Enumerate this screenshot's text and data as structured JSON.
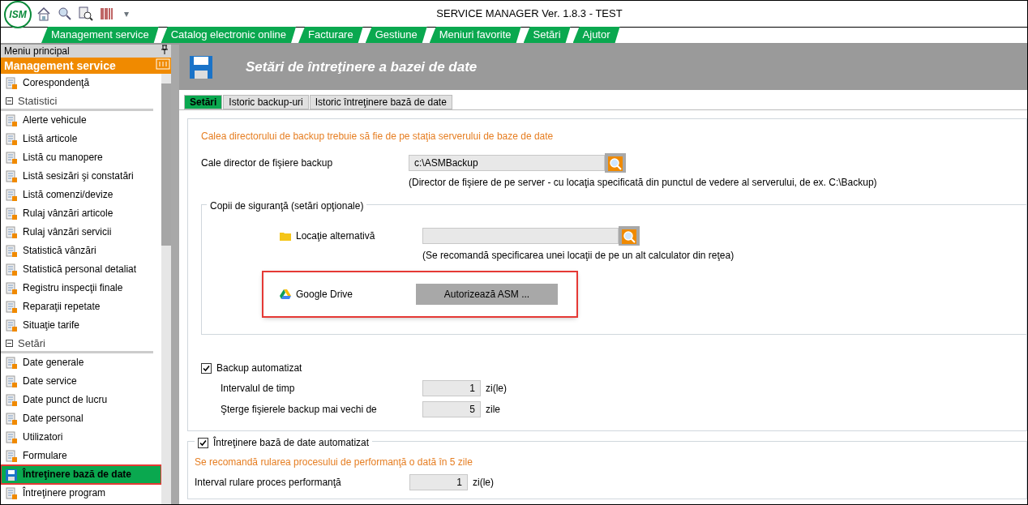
{
  "window": {
    "title": "SERVICE MANAGER Ver. 1.8.3 - TEST",
    "logo": "ISM",
    "overflow": "▾"
  },
  "menu": [
    {
      "label": "Management service"
    },
    {
      "label": "Catalog electronic online"
    },
    {
      "label": "Facturare"
    },
    {
      "label": "Gestiune"
    },
    {
      "label": "Meniuri favorite"
    },
    {
      "label": "Setări"
    },
    {
      "label": "Ajutor"
    }
  ],
  "sidebar": {
    "title": "Meniu principal",
    "header": "Management service",
    "items": [
      {
        "kind": "item",
        "label": "Corespondenţă",
        "selected": false
      },
      {
        "kind": "section",
        "label": "Statistici"
      },
      {
        "kind": "item",
        "label": "Alerte vehicule",
        "selected": false
      },
      {
        "kind": "item",
        "label": "Listă articole",
        "selected": false
      },
      {
        "kind": "item",
        "label": "Listă cu manopere",
        "selected": false
      },
      {
        "kind": "item",
        "label": "Listă sesizări şi constatări",
        "selected": false
      },
      {
        "kind": "item",
        "label": "Listă comenzi/devize",
        "selected": false
      },
      {
        "kind": "item",
        "label": "Rulaj vânzări articole",
        "selected": false
      },
      {
        "kind": "item",
        "label": "Rulaj vânzări servicii",
        "selected": false
      },
      {
        "kind": "item",
        "label": "Statistică vânzări",
        "selected": false
      },
      {
        "kind": "item",
        "label": "Statistică personal detaliat",
        "selected": false
      },
      {
        "kind": "item",
        "label": "Registru inspecţii finale",
        "selected": false
      },
      {
        "kind": "item",
        "label": "Reparaţii repetate",
        "selected": false
      },
      {
        "kind": "item",
        "label": "Situaţie tarife",
        "selected": false
      },
      {
        "kind": "section",
        "label": "Setări"
      },
      {
        "kind": "item",
        "label": "Date generale",
        "selected": false
      },
      {
        "kind": "item",
        "label": "Date service",
        "selected": false
      },
      {
        "kind": "item",
        "label": "Date punct de lucru",
        "selected": false
      },
      {
        "kind": "item",
        "label": "Date personal",
        "selected": false
      },
      {
        "kind": "item",
        "label": "Utilizatori",
        "selected": false
      },
      {
        "kind": "item",
        "label": "Formulare",
        "selected": false
      },
      {
        "kind": "item",
        "label": "Întreţinere bază de date",
        "selected": true
      },
      {
        "kind": "item",
        "label": "Întreţinere program",
        "selected": false
      }
    ]
  },
  "page": {
    "title": "Setări de întreţinere a bazei de date",
    "tabs": [
      {
        "label": "Setări",
        "selected": true
      },
      {
        "label": "Istoric backup-uri",
        "selected": false
      },
      {
        "label": "Istoric întreţinere bază de date",
        "selected": false
      }
    ],
    "backup": {
      "notice": "Calea directorului de backup trebuie să fie de pe staţia serverului de baze de date",
      "path_label": "Cale director de fişiere backup",
      "path_value": "c:\\ASMBackup",
      "path_hint": "(Director de fişiere de pe server - cu locaţia specificată din punctul de vedere al serverului, de ex. C:\\Backup)"
    },
    "copies": {
      "legend": "Copii de siguranţă (setări opţionale)",
      "alt_label": "Locaţie alternativă",
      "alt_hint": "(Se recomandă specificarea unei locaţii de pe un alt calculator din reţea)",
      "drive_label": "Google Drive",
      "drive_button": "Autorizează ASM ...",
      "highlighted": true
    },
    "auto_backup": {
      "label": "Backup automatizat",
      "checked": true,
      "rows": [
        {
          "label": "Intervalul de timp",
          "value": "1",
          "unit": "zi(le)"
        },
        {
          "label": "Şterge fişierele backup mai vechi de",
          "value": "5",
          "unit": "zile"
        }
      ]
    },
    "maintenance": {
      "label": "Întreţinere bază de date automatizat",
      "checked": true,
      "notice": "Se recomandă rularea procesului de performanţă o dată în 5 zile",
      "rows": [
        {
          "label": "Interval rulare proces performanţă",
          "value": "1",
          "unit": "zi(le)"
        }
      ]
    }
  }
}
